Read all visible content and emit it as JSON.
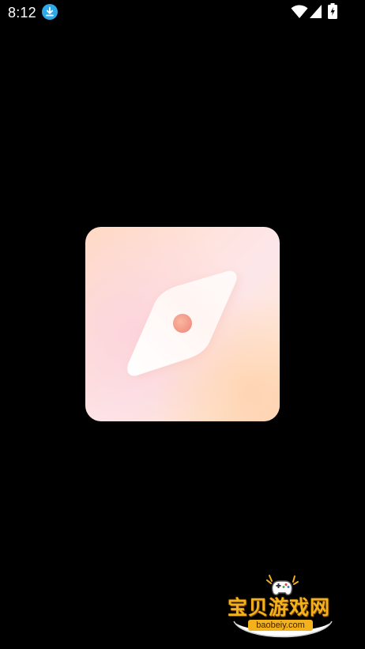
{
  "status_bar": {
    "time": "8:12",
    "icons": [
      "download-icon",
      "wifi-icon",
      "signal-icon",
      "battery-icon"
    ]
  },
  "splash": {
    "app_icon": "compass-icon",
    "colors": {
      "bg_from": "#ffd9c2",
      "bg_to": "#fdd5b8",
      "needle": "#ffffff",
      "dot": "#f4a58f"
    }
  },
  "watermark": {
    "title": "宝贝游戏网",
    "url": "baobeiy.com",
    "color": "#f3b21c"
  }
}
